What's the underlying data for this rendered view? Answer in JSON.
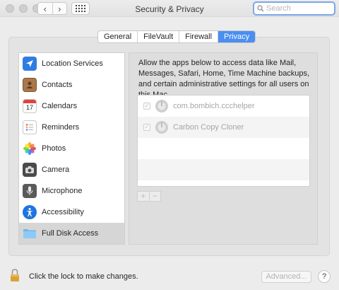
{
  "window": {
    "title": "Security & Privacy",
    "search_placeholder": "Search"
  },
  "nav": {
    "back_glyph": "‹",
    "forward_glyph": "›"
  },
  "tabs": [
    {
      "label": "General",
      "active": false
    },
    {
      "label": "FileVault",
      "active": false
    },
    {
      "label": "Firewall",
      "active": false
    },
    {
      "label": "Privacy",
      "active": true
    }
  ],
  "sidebar": {
    "items": [
      {
        "label": "Location Services",
        "icon": "location-arrow-icon"
      },
      {
        "label": "Contacts",
        "icon": "contacts-book-icon"
      },
      {
        "label": "Calendars",
        "icon": "calendar-icon",
        "icon_text": "17"
      },
      {
        "label": "Reminders",
        "icon": "reminders-list-icon"
      },
      {
        "label": "Photos",
        "icon": "photos-flower-icon"
      },
      {
        "label": "Camera",
        "icon": "camera-icon"
      },
      {
        "label": "Microphone",
        "icon": "microphone-icon"
      },
      {
        "label": "Accessibility",
        "icon": "accessibility-icon"
      },
      {
        "label": "Full Disk Access",
        "icon": "folder-icon",
        "selected": true
      }
    ]
  },
  "detail": {
    "description": "Allow the apps below to access data like Mail, Messages, Safari, Home, Time Machine backups, and certain administrative settings for all users on this Mac.",
    "apps": [
      {
        "name": "com.bombich.ccchelper",
        "checked": true,
        "icon": "ccc-helper-icon"
      },
      {
        "name": "Carbon Copy Cloner",
        "checked": true,
        "icon": "carbon-copy-cloner-icon"
      }
    ],
    "add_label": "+",
    "remove_label": "−"
  },
  "footer": {
    "lock_text": "Click the lock to make changes.",
    "advanced_label": "Advanced...",
    "help_label": "?"
  },
  "colors": {
    "accent": "#4a8ef0",
    "selection": "#d6d6d6",
    "window_bg": "#ececec"
  }
}
